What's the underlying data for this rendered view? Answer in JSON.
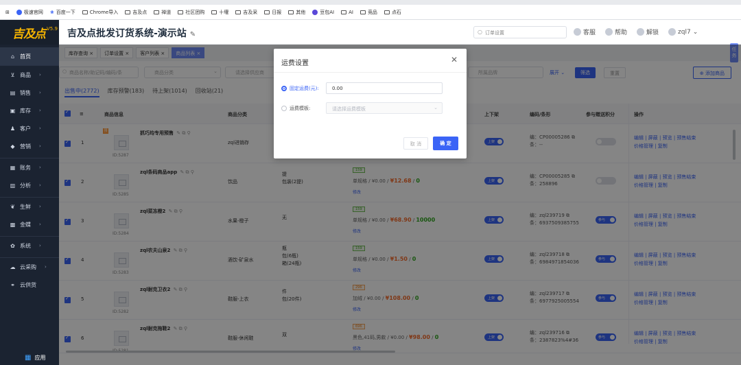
{
  "bookmarks": [
    "极速官网",
    "百度一下",
    "Chrome导入",
    "吉及点",
    "禅道",
    "社区团购",
    "十堰",
    "吉及采",
    "日报",
    "其他",
    "豆包AI",
    "AI",
    "竞品",
    "点石"
  ],
  "sidebar": {
    "logo": "吉及点",
    "version": "V5.9",
    "items": [
      "首页",
      "商品",
      "销售",
      "库存",
      "客户",
      "营销",
      "账务",
      "分析",
      "生鲜",
      "金蝶",
      "系统",
      "云采购",
      "云供货"
    ],
    "bottom": "应用"
  },
  "header": {
    "title": "吉及点批发订货系统-演示站",
    "search_placeholder": "订单设置",
    "links": [
      "客服",
      "帮助",
      "解锁",
      "zql7"
    ]
  },
  "tabs": [
    "库存查询",
    "订单设置",
    "客户列表",
    "商品列表"
  ],
  "side_tab": "任务",
  "filters": {
    "search_placeholder": "商品名称/助记码/编码/条",
    "category_placeholder": "商品分类",
    "supplier_placeholder": "请选择供应商",
    "brand_placeholder": "所属品牌",
    "expand": "展开",
    "filter_btn": "筛选",
    "reset_btn": "重置",
    "add_btn": "添加商品"
  },
  "subtabs": [
    "出售中(2772)",
    "库存预警(183)",
    "待上架(1014)",
    "回收站(21)"
  ],
  "columns": {
    "info": "商品信息",
    "category": "商品分类",
    "shelf": "上下架",
    "code": "编码/条形",
    "points": "参与赠送积分",
    "ops": "操作"
  },
  "rows": [
    {
      "no": "1",
      "name": "抓巧均专用预售",
      "id": "ID:5287",
      "category": "zql进销存",
      "units": [],
      "stock": "",
      "spec": "",
      "price1": "",
      "price2": "",
      "qty": "",
      "edit": "",
      "shelf": "上架",
      "code1": "编：CP00005286",
      "code2": "条：--",
      "code3": "",
      "points": "",
      "ops1": "编辑 | 屏蔽 | 预览 | 预售结束",
      "ops2": "价格管理 | 复制"
    },
    {
      "no": "2",
      "name": "zql条码商品app",
      "id": "ID:5285",
      "category": "饮品",
      "units": [
        "提",
        "包装(2提)"
      ],
      "stock": "159",
      "spec": "单规格",
      "price1": "¥0.00",
      "price2": "¥12.68",
      "qty": "0",
      "edit": "修改",
      "shelf": "上架",
      "code1": "编：CP00005285",
      "code2": "条：258896",
      "code3": "",
      "points": "",
      "ops1": "编辑 | 屏蔽 | 预览 | 预售结束",
      "ops2": "价格管理 | 复制"
    },
    {
      "no": "3",
      "name": "zql菜冻橙2",
      "id": "ID:5284",
      "category": "水果-橙子",
      "units": [
        "无"
      ],
      "stock": "159",
      "spec": "单规格",
      "price1": "¥0.00",
      "price2": "¥68.90",
      "qty": "10000",
      "edit": "修改",
      "shelf": "上架",
      "code1": "编：zql239719",
      "code2": "条：6937509385755",
      "code3": "",
      "points": "参与",
      "ops1": "编辑 | 屏蔽 | 预览 | 预售结束",
      "ops2": "价格管理 | 复制"
    },
    {
      "no": "4",
      "name": "zql农夫山泉2",
      "id": "ID:5283",
      "category": "酒饮-矿泉水",
      "units": [
        "瓶",
        "包(6瓶)",
        "箱(24瓶)"
      ],
      "stock": "159",
      "spec": "单规格",
      "price1": "¥0.00",
      "price2": "¥1.50",
      "qty": "0",
      "edit": "修改",
      "shelf": "上架",
      "code1": "编：zql239718",
      "code2": "条：6984971854036",
      "code3": "",
      "points": "参与",
      "ops1": "编辑 | 屏蔽 | 预览 | 预售结束",
      "ops2": "价格管理 | 复制"
    },
    {
      "no": "5",
      "name": "zql耐克卫衣2",
      "id": "ID:5282",
      "category": "鞋服-上衣",
      "units": [
        "件",
        "包(20件)"
      ],
      "stock": "296",
      "spec": "加绒",
      "price1": "¥0.00",
      "price2": "¥108.00",
      "qty": "0",
      "edit": "修改",
      "shelf": "上架",
      "code1": "编：zql239717",
      "code2": "条：6977925005554",
      "code3": "",
      "points": "参与",
      "ops1": "编辑 | 屏蔽 | 预览 | 预售结束",
      "ops2": "价格管理 | 复制"
    },
    {
      "no": "6",
      "name": "zql耐克拖鞋2",
      "id": "ID:5281",
      "category": "鞋服-休闲鞋",
      "units": [
        "双"
      ],
      "stock": "696",
      "spec": "黑色,41码,男款",
      "price1": "¥0.00",
      "price2": "¥98.00",
      "qty": "0",
      "edit": "修改",
      "shelf": "上架",
      "code1": "编：zql239716",
      "code2": "条：2387823%4#36",
      "code3": "",
      "points": "参与",
      "ops1": "编辑 | 屏蔽 | 预览 | 预售结束",
      "ops2": "价格管理 | 复制"
    }
  ],
  "modal": {
    "title": "运费设置",
    "fixed_label": "固定运费(元):",
    "fixed_value": "0.00",
    "template_label": "运费模板:",
    "template_placeholder": "请选择运费模板",
    "cancel": "取 消",
    "ok": "确 定"
  }
}
